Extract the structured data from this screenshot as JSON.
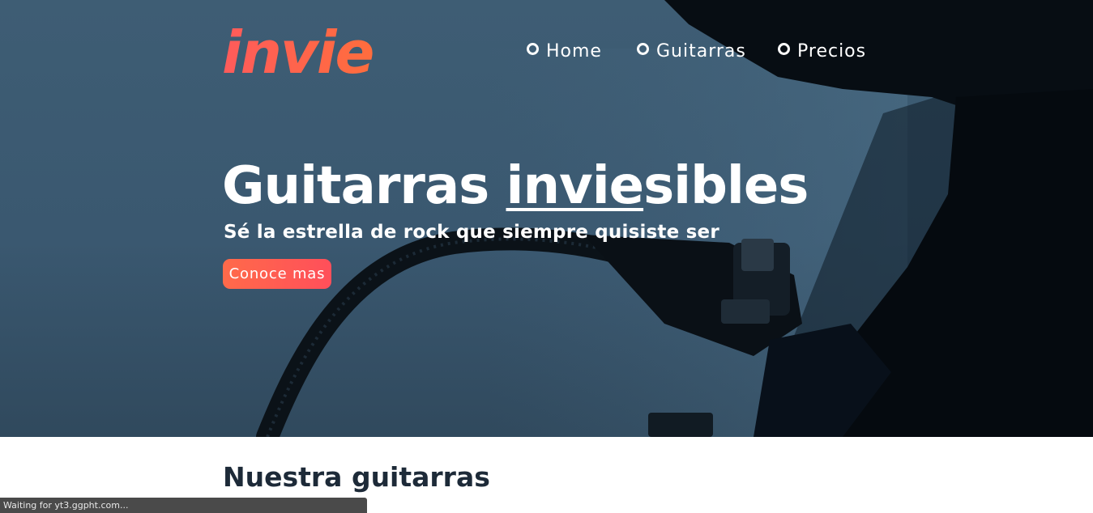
{
  "brand": {
    "logo_text": "invie"
  },
  "nav": {
    "items": [
      {
        "label": "Home"
      },
      {
        "label": "Guitarras"
      },
      {
        "label": "Precios"
      }
    ]
  },
  "hero": {
    "title_main": "Guitarras ",
    "title_accent": "invie",
    "title_rest": "sibles",
    "subtitle": "Sé la estrella de rock que siempre quisiste ser",
    "cta_label": "Conoce mas"
  },
  "section": {
    "title": "Nuestra guitarras"
  },
  "browser_status": {
    "text": "Waiting for yt3.ggpht.com..."
  },
  "colors": {
    "hero_bg": "#3a5870",
    "accent": "#ff5b5b",
    "heading_dark": "#1d2a38"
  }
}
